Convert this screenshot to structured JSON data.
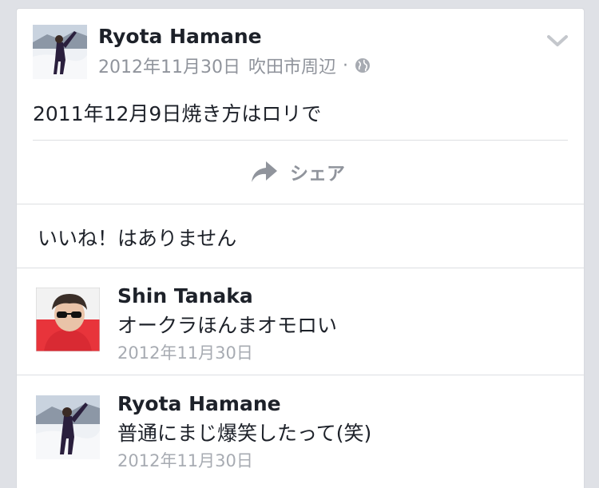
{
  "post": {
    "author": "Ryota Hamane",
    "date": "2012年11月30日",
    "location": "吹田市周辺",
    "separator": "·",
    "privacy_icon": "globe-icon",
    "menu_icon": "chevron-down-icon",
    "text": "2011年12月9日焼き方はロリで"
  },
  "actions": {
    "share_label": "シェア",
    "share_icon": "share-arrow-icon"
  },
  "likes": {
    "text": "いいね！はありません"
  },
  "comments": [
    {
      "author": "Shin Tanaka",
      "text": "オークラほんまオモロい",
      "date": "2012年11月30日"
    },
    {
      "author": "Ryota Hamane",
      "text": "普通にまじ爆笑したって(笑)",
      "date": "2012年11月30日"
    }
  ],
  "colors": {
    "background": "#dfe1e6",
    "card": "#ffffff",
    "primary_text": "#1d2129",
    "secondary_text": "#90949c"
  }
}
